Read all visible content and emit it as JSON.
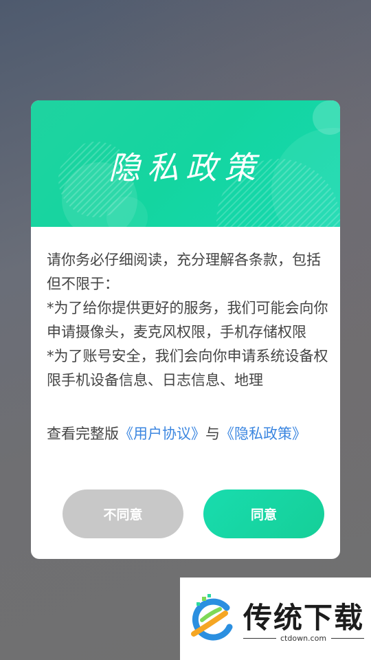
{
  "dialog": {
    "title": "隐私政策",
    "body_paragraphs": [
      "请你务必仔细阅读，充分理解各条款，包括但不限于：",
      "*为了给你提供更好的服务，我们可能会向你申请摄像头，麦克风权限，手机存储权限",
      "*为了账号安全，我们会向你申请系统设备权限手机设备信息、日志信息、地理"
    ],
    "links_line": {
      "prefix": "查看完整版",
      "user_agreement": "《用户协议》",
      "joiner": "与",
      "privacy_policy": "《隐私政策》"
    },
    "buttons": {
      "disagree": "不同意",
      "agree": "同意"
    }
  },
  "watermark": {
    "brand": "传统下载",
    "url": "ctdown.com"
  },
  "colors": {
    "accent": "#16d6a6",
    "link": "#3b86e0",
    "disabled_button": "#c8c8c8"
  }
}
